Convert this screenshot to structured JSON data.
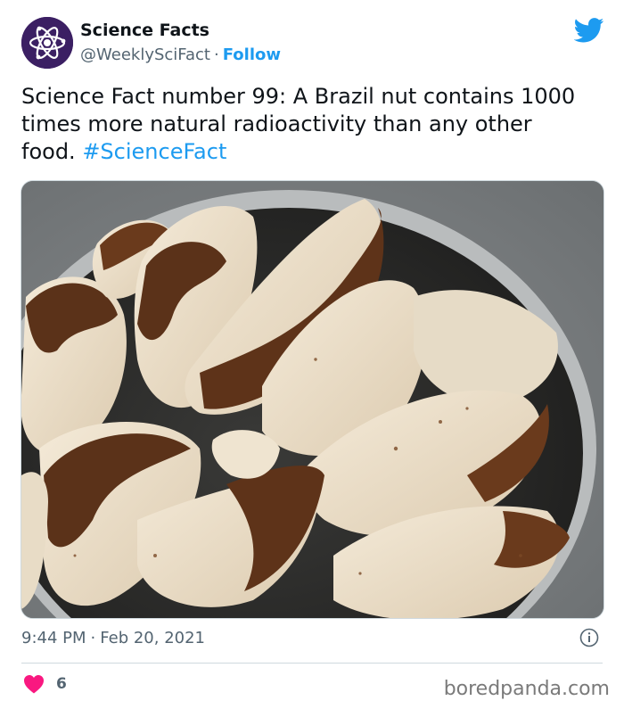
{
  "author": {
    "display_name": "Science Facts",
    "handle": "@WeeklySciFact",
    "separator": "·",
    "follow_label": "Follow",
    "avatar_icon": "atom-icon",
    "avatar_bg": "#3b1f63"
  },
  "platform_icon": "twitter-bird-icon",
  "tweet": {
    "text": "Science Fact number 99: A Brazil nut contains 1000 times more natural radioactivity than any other food. ",
    "hashtag": "#ScienceFact",
    "media_description_icon": "photo-brazil-nuts"
  },
  "meta": {
    "time": "9:44 PM",
    "separator": "·",
    "date": "Feb 20, 2021",
    "info_icon": "info-icon"
  },
  "engagement": {
    "like_icon": "heart-icon",
    "like_count": "6"
  },
  "watermark": "boredpanda.com",
  "colors": {
    "accent": "#1d9bf0",
    "heart": "#f91880",
    "text": "#0f1419",
    "muted": "#536471"
  }
}
